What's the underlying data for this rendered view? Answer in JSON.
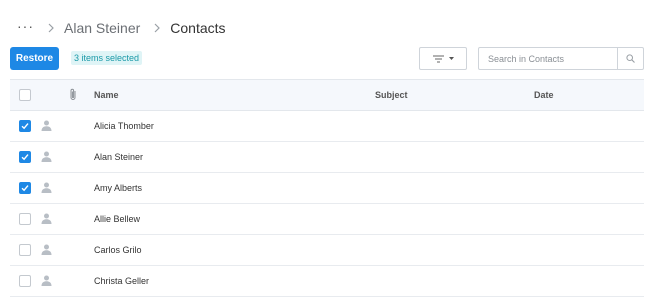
{
  "breadcrumb": {
    "more": "···",
    "items": [
      {
        "label": "Alan Steiner"
      },
      {
        "label": "Contacts"
      }
    ]
  },
  "toolbar": {
    "restore_label": "Restore",
    "selection_badge": "3 items selected",
    "filter_icon": "filter-icon",
    "search_placeholder": "Search in Contacts",
    "search_value": ""
  },
  "table": {
    "columns": {
      "name": "Name",
      "subject": "Subject",
      "date": "Date"
    },
    "rows": [
      {
        "name": "Alicia Thomber",
        "subject": "",
        "date": "",
        "checked": true
      },
      {
        "name": "Alan Steiner",
        "subject": "",
        "date": "",
        "checked": true
      },
      {
        "name": "Amy Alberts",
        "subject": "",
        "date": "",
        "checked": true
      },
      {
        "name": "Allie Bellew",
        "subject": "",
        "date": "",
        "checked": false
      },
      {
        "name": "Carlos Grilo",
        "subject": "",
        "date": "",
        "checked": false
      },
      {
        "name": "Christa Geller",
        "subject": "",
        "date": "",
        "checked": false
      }
    ]
  },
  "colors": {
    "accent": "#1e88e5",
    "badge_bg": "#dff4f6",
    "badge_text": "#1b9aa8",
    "header_bg": "#f5f8fc"
  }
}
